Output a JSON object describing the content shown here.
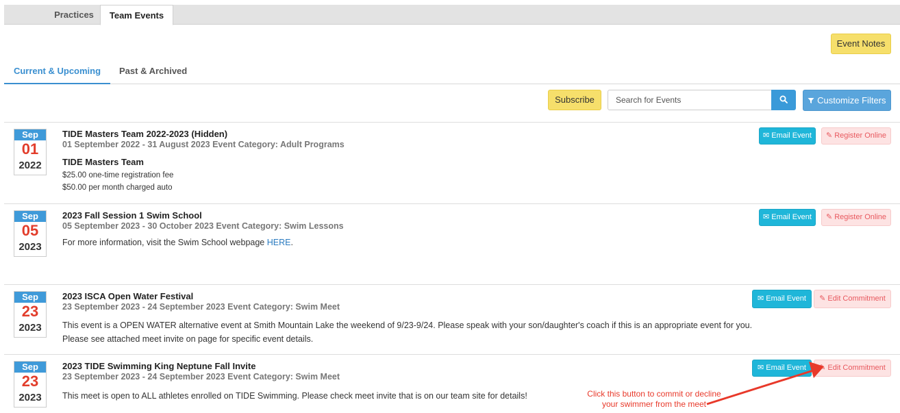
{
  "top_tabs": [
    "Practices",
    "Team Events"
  ],
  "event_notes_label": "Event Notes",
  "sub_tabs": [
    "Current & Upcoming",
    "Past & Archived"
  ],
  "toolbar": {
    "subscribe_label": "Subscribe",
    "search_placeholder": "Search for Events",
    "customize_label": "Customize Filters"
  },
  "icons": {
    "search": "search-icon",
    "filter": "filter-icon",
    "email": "envelope-icon",
    "edit": "edit-icon"
  },
  "colors": {
    "accent_blue": "#3f9ad9",
    "date_red": "#e23d2b",
    "email_btn": "#1fb6d9",
    "yellow_btn": "#f6df6b",
    "pink_btn": "#fde3e3",
    "annotation_red": "#e8392a"
  },
  "events": [
    {
      "month": "Sep",
      "day": "01",
      "year": "2022",
      "title": "TIDE Masters Team 2022-2023 (Hidden)",
      "dates": "01 September 2022 - 31 August 2023 Event Category: Adult Programs",
      "subtitle": "TIDE Masters Team",
      "lines": [
        "$25.00 one-time registration fee",
        "$50.00 per month charged auto"
      ],
      "email_label": "Email Event",
      "action_label": "Register Online"
    },
    {
      "month": "Sep",
      "day": "05",
      "year": "2023",
      "title": "2023 Fall Session 1 Swim School",
      "dates": "05 September 2023 - 30 October 2023 Event Category: Swim Lessons",
      "body_prefix": "For more information, visit the Swim School webpage ",
      "body_link": "HERE",
      "body_suffix": ".",
      "email_label": "Email Event",
      "action_label": "Register Online"
    },
    {
      "month": "Sep",
      "day": "23",
      "year": "2023",
      "title": "2023 ISCA Open Water Festival",
      "dates": "23 September 2023 - 24 September 2023 Event Category: Swim Meet",
      "lines": [
        "This event is a OPEN WATER alternative event at Smith Mountain Lake the weekend of 9/23-9/24.  Please speak with your son/daughter's coach if this is an appropriate event for you.",
        "Please see attached meet invite on page for specific event details."
      ],
      "email_label": "Email Event",
      "action_label": "Edit Commitment"
    },
    {
      "month": "Sep",
      "day": "23",
      "year": "2023",
      "title": "2023 TIDE Swimming King Neptune Fall Invite",
      "dates": "23 September 2023 - 24 September 2023 Event Category: Swim Meet",
      "lines": [
        "This meet is open to ALL athletes enrolled on TIDE Swimming.  Please check meet invite that is on our team site for details!"
      ],
      "email_label": "Email Event",
      "action_label": "Edit Commitment"
    }
  ],
  "annotation": {
    "line1": "Click this button to commit or decline",
    "line2": "your swimmer from the meet"
  }
}
